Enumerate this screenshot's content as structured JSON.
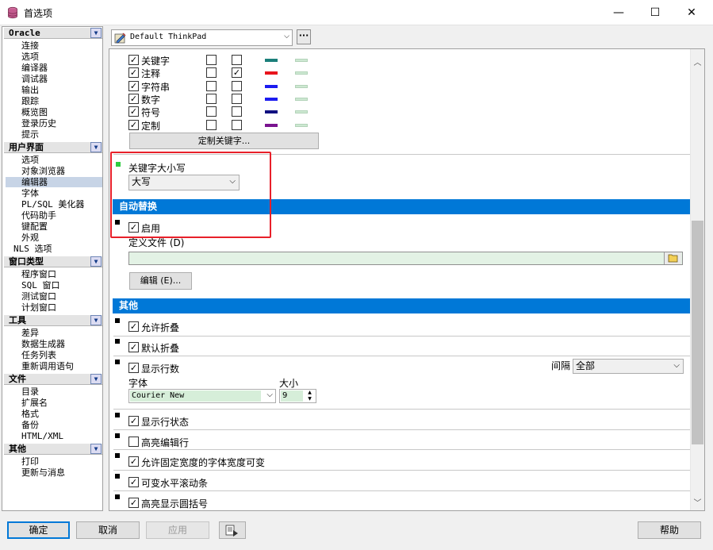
{
  "window": {
    "title": "首选项",
    "controls": {
      "minimize": "—",
      "maximize": "☐",
      "close": "✕"
    }
  },
  "nav": {
    "groups": [
      {
        "label": "Oracle",
        "items": [
          "连接",
          "选项",
          "编译器",
          "调试器",
          "输出",
          "跟踪",
          "概览图",
          "登录历史",
          "提示"
        ]
      },
      {
        "label": "用户界面",
        "items": [
          "选项",
          "对象浏览器",
          "编辑器",
          "字体",
          "PL/SQL 美化器",
          "代码助手",
          "键配置",
          "外观",
          "NLS 选项"
        ],
        "selected": "编辑器"
      },
      {
        "label": "窗口类型",
        "items": [
          "程序窗口",
          "SQL 窗口",
          "测试窗口",
          "计划窗口"
        ]
      },
      {
        "label": "工具",
        "items": [
          "差异",
          "数据生成器",
          "任务列表",
          "重新调用语句"
        ]
      },
      {
        "label": "文件",
        "items": [
          "目录",
          "扩展名",
          "格式",
          "备份",
          "HTML/XML"
        ]
      },
      {
        "label": "其他",
        "items": [
          "打印",
          "更新与消息"
        ]
      }
    ]
  },
  "profile": {
    "value": "Default ThinkPad",
    "more_label": "···"
  },
  "syntax": {
    "rows": [
      {
        "label": "关键字",
        "enabled": true,
        "c1": false,
        "c2": false,
        "color": "#1b7f7a"
      },
      {
        "label": "注释",
        "enabled": true,
        "c1": false,
        "c2": true,
        "color": "#e8141c"
      },
      {
        "label": "字符串",
        "enabled": true,
        "c1": false,
        "c2": false,
        "color": "#1c1cf0"
      },
      {
        "label": "数字",
        "enabled": true,
        "c1": false,
        "c2": false,
        "color": "#1c1cf0"
      },
      {
        "label": "符号",
        "enabled": true,
        "c1": false,
        "c2": false,
        "color": "#101080"
      },
      {
        "label": "定制",
        "enabled": true,
        "c1": false,
        "c2": false,
        "color": "#7a1490"
      }
    ],
    "custom_keywords_btn": "定制关键字..."
  },
  "keyword_case": {
    "label": "关键字大小写",
    "value": "大写"
  },
  "autoreplace": {
    "header": "自动替换",
    "enabled_label": "启用",
    "enabled": true,
    "file_label": "定义文件 (D)",
    "file_value": "",
    "edit_btn": "编辑 (E)..."
  },
  "other": {
    "header": "其他",
    "allow_fold": {
      "label": "允许折叠",
      "checked": true
    },
    "default_fold": {
      "label": "默认折叠",
      "checked": true
    },
    "show_line_numbers": {
      "label": "显示行数",
      "checked": true
    },
    "interval_label": "间隔",
    "interval_value": "全部",
    "font_label": "字体",
    "font_value": "Courier New",
    "size_label": "大小",
    "size_value": "9",
    "show_line_status": {
      "label": "显示行状态",
      "checked": true
    },
    "highlight_edit_line": {
      "label": "高亮编辑行",
      "checked": false
    },
    "fixed_width": {
      "label": "允许固定宽度的字体宽度可变",
      "checked": true
    },
    "variable_hscroll": {
      "label": "可变水平滚动条",
      "checked": true
    },
    "highlight_brackets": {
      "label": "高亮显示圆括号",
      "checked": true
    }
  },
  "buttons": {
    "ok": "确定",
    "cancel": "取消",
    "apply": "应用",
    "help": "帮助"
  }
}
